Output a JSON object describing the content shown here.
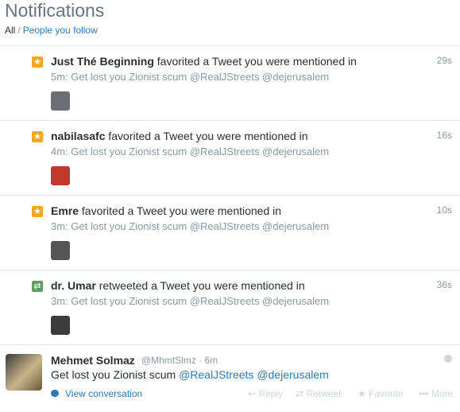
{
  "header": {
    "title": "Notifications",
    "filter_all": "All",
    "filter_sep": "/",
    "filter_follow": "People you follow"
  },
  "notifications": [
    {
      "icon": "star-icon",
      "user": "Just Thé Beginning",
      "action": "favorited a Tweet you were mentioned in",
      "preview": "5m: Get lost you Zionist scum @RealJStreets @dejerusalem",
      "time": "29s",
      "avatar_color": "#6b6f74"
    },
    {
      "icon": "star-icon",
      "user": "nabilasafc",
      "action": "favorited a Tweet you were mentioned in",
      "preview": "4m: Get lost you Zionist scum @RealJStreets @dejerusalem",
      "time": "16s",
      "avatar_color": "#c0392b"
    },
    {
      "icon": "star-icon",
      "user": "Emre",
      "action": "favorited a Tweet you were mentioned in",
      "preview": "3m: Get lost you Zionist scum @RealJStreets @dejerusalem",
      "time": "10s",
      "avatar_color": "#555555"
    },
    {
      "icon": "retweet-icon",
      "user": "dr. Umar",
      "action": "retweeted a Tweet you were mentioned in",
      "preview": "3m: Get lost you Zionist scum @RealJStreets @dejerusalem",
      "time": "36s",
      "avatar_color": "#3b3b3b"
    }
  ],
  "tweet": {
    "name": "Mehmet Solmaz",
    "handle": "@MhmtSlmz",
    "dot": "·",
    "time": "6m",
    "text_plain": "Get lost you Zionist scum ",
    "mention1": "@RealJStreets",
    "mention2": "@dejerusalem",
    "view_conversation": "View conversation",
    "reply": "Reply",
    "retweet": "Retweet",
    "favorite": "Favorite",
    "more": "More"
  }
}
